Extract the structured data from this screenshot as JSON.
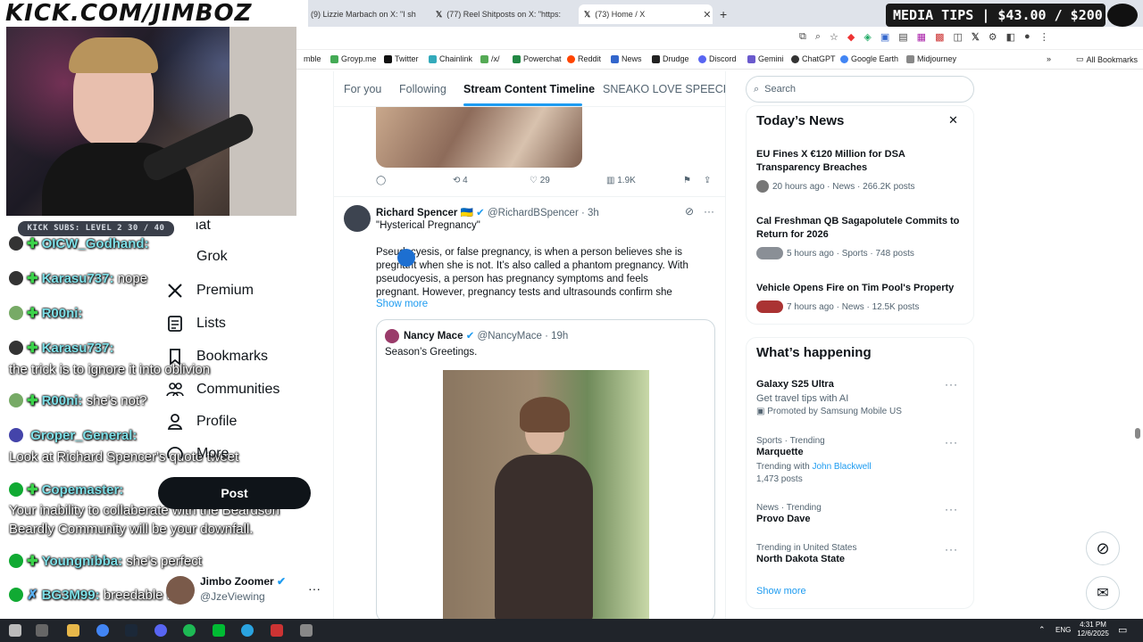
{
  "overlay": {
    "logo_text": "KICK.COM/JIMBOZ",
    "media_tips": "MEDIA TIPS | $43.00 / $200.00",
    "kick_subs": "KICK SUBS: LEVEL 2 30 / 40"
  },
  "chat": [
    {
      "name": "OICW_Godhand:",
      "msg": ""
    },
    {
      "name": "Karasu737:",
      "msg": "nope"
    },
    {
      "name": "R00ni:",
      "msg": ""
    },
    {
      "name": "Karasu737:",
      "msg": ""
    },
    {
      "name": "",
      "msg": "the trick is to ignore it into oblivion"
    },
    {
      "name": "R00ni:",
      "msg": "she's not?"
    },
    {
      "name": "Groper_General:",
      "msg": ""
    },
    {
      "name": "",
      "msg": "Look at Richard Spencer's quote tweet"
    },
    {
      "name": "Copemaster:",
      "msg": ""
    },
    {
      "name": "",
      "msg": "Your inability to collaberate with the Beardson"
    },
    {
      "name": "",
      "msg": "Beardly Community will be your downfall."
    },
    {
      "name": "Youngnibba:",
      "msg": "she's perfect"
    },
    {
      "name": "BG3M99:",
      "msg": "breedable tbh"
    }
  ],
  "browser": {
    "tabs": [
      {
        "label": "(9) Lizzie Marbach on X: \"I sh"
      },
      {
        "label": "(77) Reel Shitposts on X: \"https:"
      },
      {
        "label": "(73) Home / X"
      }
    ],
    "bookmarks": [
      "mble",
      "Groyp.me",
      "Twitter",
      "Chainlink",
      "/x/",
      "Powerchat",
      "Reddit",
      "News",
      "Drudge",
      "Discord",
      "Gemini",
      "ChatGPT",
      "Google Earth",
      "Midjourney"
    ],
    "all_bookmarks": "All Bookmarks"
  },
  "nav": {
    "items": [
      "Chat",
      "Grok",
      "Premium",
      "Lists",
      "Bookmarks",
      "Communities",
      "Profile",
      "More"
    ],
    "post_label": "Post",
    "user_name": "Jimbo Zoomer",
    "user_handle": "@JzeViewing"
  },
  "main": {
    "tabs": [
      "For you",
      "Following",
      "Stream Content Timeline",
      "SNEAKO LOVE SPEECH"
    ],
    "prev_tweet": {
      "retweets": "4",
      "likes": "29",
      "views": "1.9K"
    },
    "tweet": {
      "name": "Richard Spencer 🇺🇦",
      "handle": "@RichardBSpencer · 3h",
      "title": "\"Hysterical Pregnancy\"",
      "body": "Pseudocyesis, or false pregnancy, is when a person believes she is pregnant when she is not. It’s also called a phantom pregnancy. With pseudocyesis, a person has pregnancy symptoms and feels pregnant. However, pregnancy tests and ultrasounds confirm she",
      "show_more": "Show more",
      "quote_name": "Nancy Mace",
      "quote_handle": "@NancyMace · 19h",
      "quote_text": "Season’s Greetings."
    }
  },
  "right": {
    "search_placeholder": "Search",
    "news_title": "Today’s News",
    "news": [
      {
        "title": "EU Fines X €120 Million for DSA Transparency Breaches",
        "meta": "20 hours ago · News · 266.2K posts"
      },
      {
        "title": "Cal Freshman QB Sagapolutele Commits to Return for 2026",
        "meta": "5 hours ago · Sports · 748 posts"
      },
      {
        "title": "Vehicle Opens Fire on Tim Pool's Property",
        "meta": "7 hours ago · News · 12.5K posts"
      }
    ],
    "happening_title": "What’s happening",
    "trends": [
      {
        "context": "",
        "name": "Galaxy S25 Ultra",
        "sub": "Get travel tips with AI",
        "extra": "Promoted by Samsung Mobile US"
      },
      {
        "context": "Sports · Trending",
        "name": "Marquette",
        "sub": "Trending with",
        "link": "John Blackwell",
        "extra": "1,473 posts"
      },
      {
        "context": "News · Trending",
        "name": "Provo Dave",
        "sub": "",
        "extra": ""
      },
      {
        "context": "Trending in United States",
        "name": "North Dakota State",
        "sub": "",
        "extra": ""
      }
    ],
    "show_more": "Show more"
  },
  "taskbar": {
    "lang": "ENG",
    "time": "4:31 PM",
    "date": "12/6/2025"
  }
}
